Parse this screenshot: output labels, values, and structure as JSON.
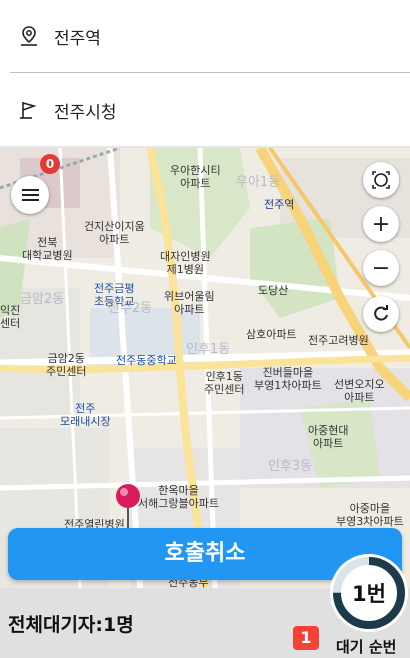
{
  "route": {
    "origin": "전주역",
    "destination": "전주시청"
  },
  "map": {
    "menu_badge": "0",
    "labels": {
      "udahan": "우아한시티\n아파트",
      "jeonjuyeok": "전주역",
      "jeonbuk_hosp": "전북\n대학교병원",
      "geonji": "건지산이지움\n아파트",
      "daeja": "대자인병원\n제1병원",
      "doda": "도당산",
      "jeonju_geumpyeong": "전주금평\n초등학교",
      "wibeu": "위브어울림\n아파트",
      "samho": "삼호아파트",
      "jeonju_goryeo": "전주고려병원",
      "geumam2": "금암2동\n주민센터",
      "jeonju_dong_ms": "전주동중학교",
      "inhu1": "인후1동\n주민센터",
      "jinbeo": "진버들마을\n부영1차아파트",
      "seonbyeon": "선변오지오\n아파트",
      "jeonju_market": "전주\n모래내시장",
      "ajung": "아중현대\n아파트",
      "hanok": "한옥마을\n서해그랑블아파트",
      "ajung_buyoung": "아중마을\n부영3차아파트",
      "jeonju_yeolin": "전주열린병원",
      "left_edge": "익진\n센터",
      "faint_geumam": "금암2동",
      "faint_inhu1": "인후1동",
      "faint_inhu3": "인후3동",
      "faint_ua": "우아1동",
      "faint_jeonju2": "전주2동",
      "bottom_partial": "전주동부"
    }
  },
  "actions": {
    "cancel_call": "호출취소"
  },
  "status": {
    "total_waiting": "전체대기자:1명",
    "queue_rank_badge": "1",
    "queue_rank_label": "대기 순번",
    "queue_dial_number": "1번",
    "dial_progress": 0.75
  },
  "colors": {
    "accent": "#2196f3",
    "badge_red": "#e53935",
    "dial_ring": "#1c3a4a"
  },
  "icons": [
    "location-pin-icon",
    "flag-icon",
    "menu-icon",
    "my-location-icon",
    "zoom-in-icon",
    "zoom-out-icon",
    "refresh-icon"
  ]
}
